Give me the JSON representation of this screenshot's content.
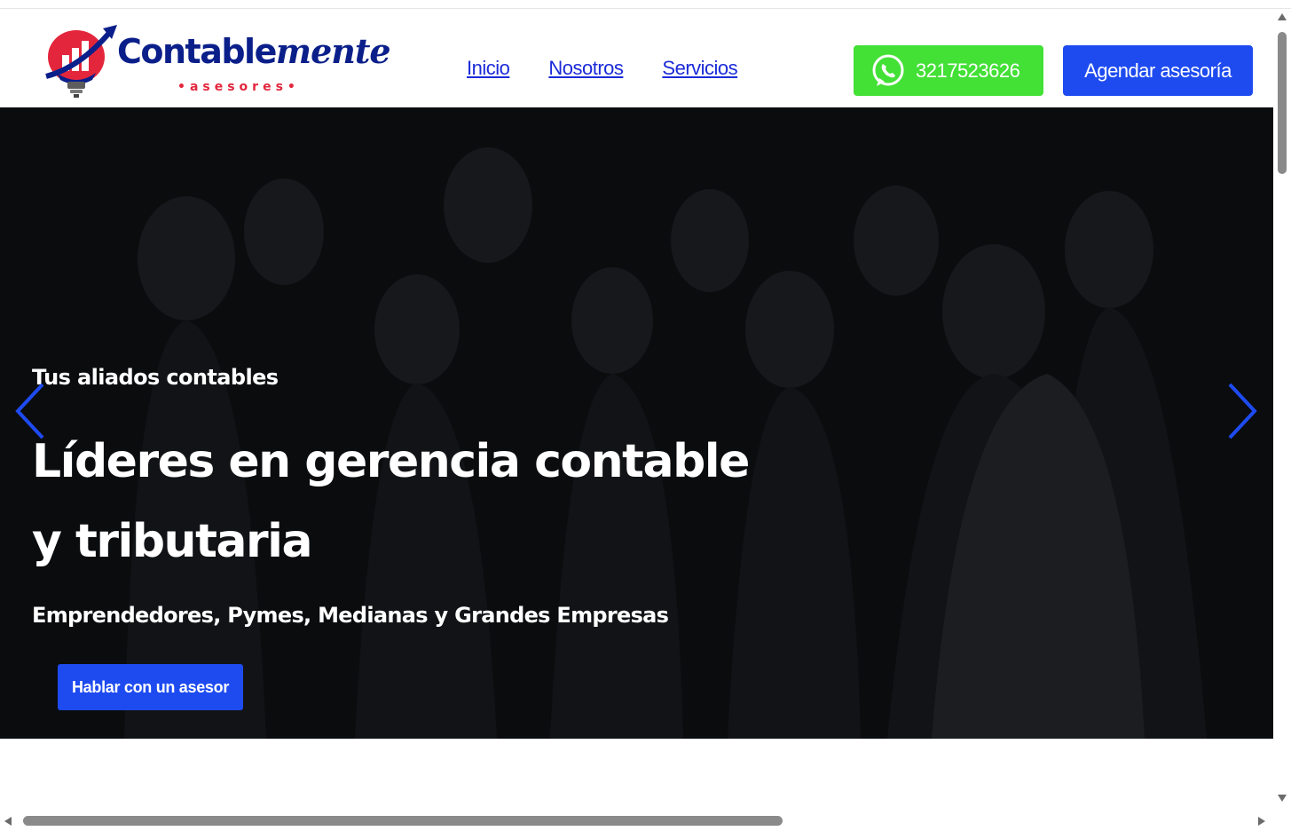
{
  "header": {
    "logo": {
      "word_bold": "Contable",
      "word_script": "mente",
      "sub": "•asesores•"
    },
    "nav": [
      {
        "label": "Inicio"
      },
      {
        "label": "Nosotros"
      },
      {
        "label": "Servicios"
      }
    ],
    "whatsapp": {
      "label": "3217523626",
      "icon": "whatsapp-icon",
      "color": "#43e036"
    },
    "agendar": {
      "label": "Agendar asesoría",
      "color": "#1e4bf0"
    }
  },
  "hero": {
    "eyebrow": "Tus aliados contables",
    "title": "Líderes en gerencia contable y tributaria",
    "subtitle": "Emprendedores, Pymes, Medianas y Grandes Empresas",
    "cta": "Hablar con un asesor",
    "prev_icon": "chevron-left-icon",
    "next_icon": "chevron-right-icon",
    "arrow_color": "#1e4bf0"
  },
  "colors": {
    "brand_blue": "#0b1f8a",
    "accent_red": "#e3263c",
    "link_blue": "#1b2bd8",
    "button_blue": "#1e4bf0",
    "hero_background": "#0b0c0e"
  }
}
